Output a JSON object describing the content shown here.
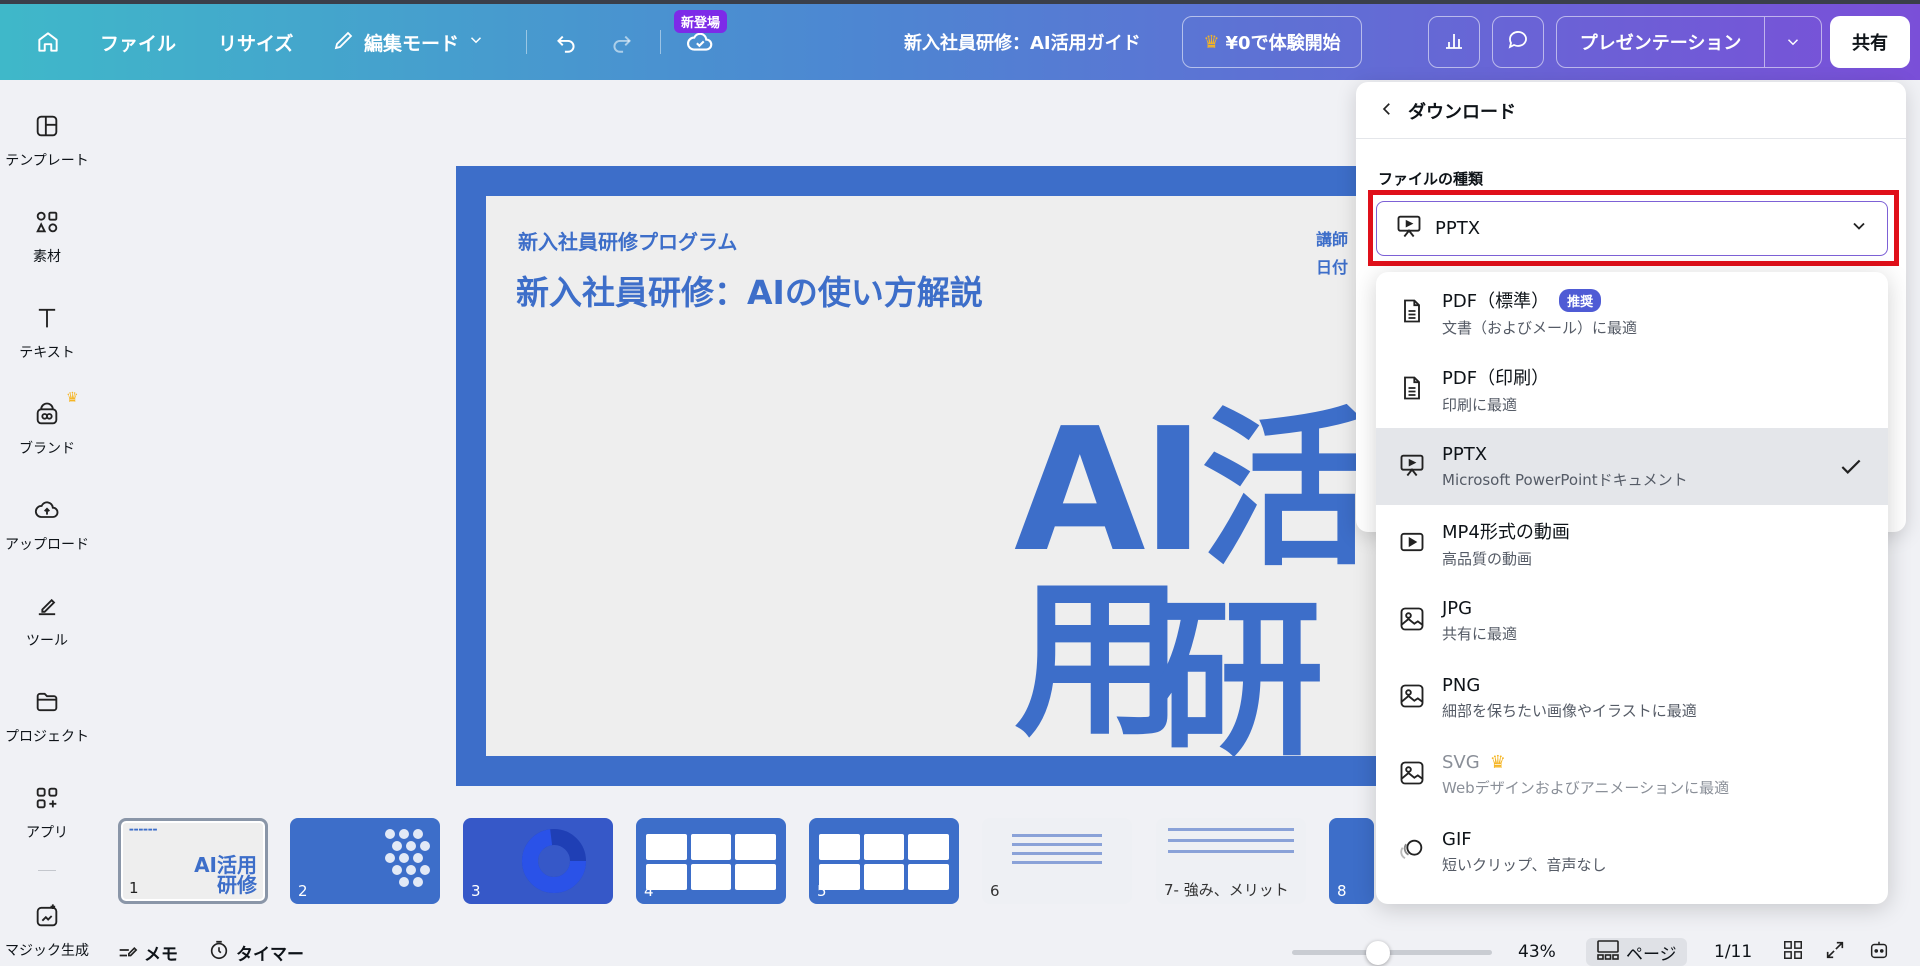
{
  "topbar": {
    "file_label": "ファイル",
    "resize_label": "リサイズ",
    "edit_mode_label": "編集モード",
    "new_badge": "新登場",
    "doc_title": "新入社員研修：AI活用ガイド",
    "trial_label": "¥0で体験開始",
    "present_label": "プレゼンテーション",
    "share_label": "共有"
  },
  "sidebar": {
    "items": [
      {
        "label": "テンプレート",
        "icon": "template-icon"
      },
      {
        "label": "素材",
        "icon": "elements-icon"
      },
      {
        "label": "テキスト",
        "icon": "text-icon"
      },
      {
        "label": "ブランド",
        "icon": "brand-icon"
      },
      {
        "label": "アップロード",
        "icon": "upload-icon"
      },
      {
        "label": "ツール",
        "icon": "tools-icon"
      },
      {
        "label": "プロジェクト",
        "icon": "folder-icon"
      },
      {
        "label": "アプリ",
        "icon": "apps-icon"
      },
      {
        "label": "マジック生成",
        "icon": "magic-icon"
      }
    ]
  },
  "slide": {
    "subtitle": "新入社員研修プログラム",
    "title": "新入社員研修：AIの使い方解説",
    "meta1": "講師",
    "meta2": "日付",
    "big1": "AI活用",
    "big2": "研修"
  },
  "thumbnails": [
    {
      "num": "1",
      "label": ""
    },
    {
      "num": "2",
      "label": ""
    },
    {
      "num": "3",
      "label": ""
    },
    {
      "num": "4",
      "label": ""
    },
    {
      "num": "5",
      "label": ""
    },
    {
      "num": "6",
      "label": ""
    },
    {
      "num": "7",
      "label": "- 強み、メリット"
    },
    {
      "num": "8",
      "label": ""
    }
  ],
  "bottombar": {
    "memo_label": "メモ",
    "timer_label": "タイマー",
    "zoom": "43%",
    "zoom_fraction": 0.43,
    "page_label": "ページ",
    "page_count": "1/11"
  },
  "download": {
    "title": "ダウンロード",
    "file_type_label": "ファイルの種類",
    "selected": "PPTX",
    "options": [
      {
        "name": "PDF（標準）",
        "badge": "推奨",
        "desc": "文書（およびメール）に最適",
        "icon": "document-icon"
      },
      {
        "name": "PDF（印刷）",
        "desc": "印刷に最適",
        "icon": "document-icon"
      },
      {
        "name": "PPTX",
        "desc": "Microsoft PowerPointドキュメント",
        "icon": "presentation-icon",
        "selected": true
      },
      {
        "name": "MP4形式の動画",
        "desc": "高品質の動画",
        "icon": "video-icon"
      },
      {
        "name": "JPG",
        "desc": "共有に最適",
        "icon": "image-icon"
      },
      {
        "name": "PNG",
        "desc": "細部を保ちたい画像やイラストに最適",
        "icon": "image-icon"
      },
      {
        "name": "SVG",
        "desc": "Webデザインおよびアニメーションに最適",
        "icon": "image-icon",
        "premium": true
      },
      {
        "name": "GIF",
        "desc": "短いクリップ、音声なし",
        "icon": "gif-icon"
      }
    ]
  },
  "colors": {
    "accent_blue": "#3d6ec9",
    "highlight_red": "#e0101a",
    "brand_purple": "#7d2ae8"
  }
}
